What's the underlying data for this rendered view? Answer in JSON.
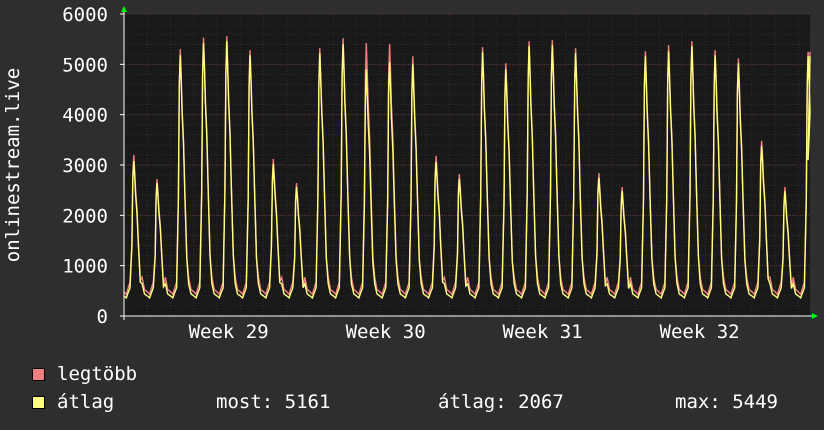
{
  "chart_data": {
    "type": "line",
    "ylabel": "onlinestream.live",
    "ylim": [
      0,
      6000
    ],
    "yticks": [
      0,
      1000,
      2000,
      3000,
      4000,
      5000,
      6000
    ],
    "x_range_days": [
      0,
      29.5
    ],
    "xticks": [
      {
        "label": "Week 29",
        "day": 4.5
      },
      {
        "label": "Week 30",
        "day": 11.25
      },
      {
        "label": "Week 31",
        "day": 18.0
      },
      {
        "label": "Week 32",
        "day": 24.75
      }
    ],
    "grid": true,
    "colors": {
      "background": "#2e2e2e",
      "plot_bg": "#191919",
      "grid_major": "#5a3a3a",
      "grid_minor": "#3a2a2a",
      "axis": "#ffffff",
      "arrow": "#00ff00",
      "max_series": "#f08080",
      "avg_series": "#ffff80"
    },
    "daily_peaks": {
      "max": [
        3200,
        2720,
        5300,
        5530,
        5560,
        5280,
        3120,
        2640,
        5320,
        5520,
        5420,
        5400,
        5160,
        3180,
        2820,
        5340,
        5020,
        5460,
        5480,
        5320,
        2840,
        2560,
        5260,
        5380,
        5460,
        5280,
        5120,
        3480,
        2560,
        5250
      ],
      "avg": [
        3080,
        2640,
        5180,
        5420,
        5460,
        5180,
        3020,
        2560,
        5220,
        5400,
        4900,
        5040,
        5000,
        3060,
        2720,
        5240,
        4900,
        5360,
        5380,
        5220,
        2740,
        2480,
        5160,
        5260,
        5360,
        5180,
        5020,
        3380,
        2480,
        5161
      ]
    },
    "daily_trough": {
      "max": 480,
      "avg": 400
    },
    "series": [
      {
        "name": "legtöbb"
      },
      {
        "name": "átlag"
      }
    ]
  },
  "legend": {
    "max_label": "legtöbb",
    "avg_label": "átlag",
    "now_text": "most: 5161",
    "avg_text": "átlag: 2067",
    "max_text": "max: 5449"
  }
}
